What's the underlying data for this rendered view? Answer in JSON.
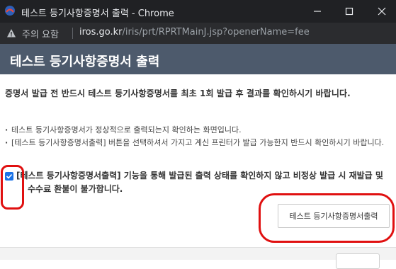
{
  "window": {
    "title": "테스트 등기사항증명서 출력 - Chrome"
  },
  "addressbar": {
    "security_label": "주의 요함",
    "url_host": "iros.go.kr",
    "url_path": "/iris/prt/RPRTMainJ.jsp?openerName=fee"
  },
  "page": {
    "title": "테스트 등기사항증명서 출력",
    "intro": "증명서 발급 전 반드시 테스트 등기사항증명서를 최초 1회 발급 후 결과를 확인하시기 바랍니다.",
    "bullets": [
      "테스트 등기사항증명서가 정상적으로 출력되는지 확인하는 화면입니다.",
      "[테스트 등기사항증명서출력] 버튼을 선택하셔서 가지고 계신 프린터가 발급 가능한지 반드시 확인하시기 바랍니다."
    ],
    "agree": {
      "checked": true,
      "text": "[테스트 등기사항증명서출력] 기능을 통해 발급된 출력 상태를 확인하지 않고 비정상 발급 시 재발급 및 수수료 환불이 불가합니다."
    },
    "print_button": "테스트 등기사항증명서출력"
  }
}
